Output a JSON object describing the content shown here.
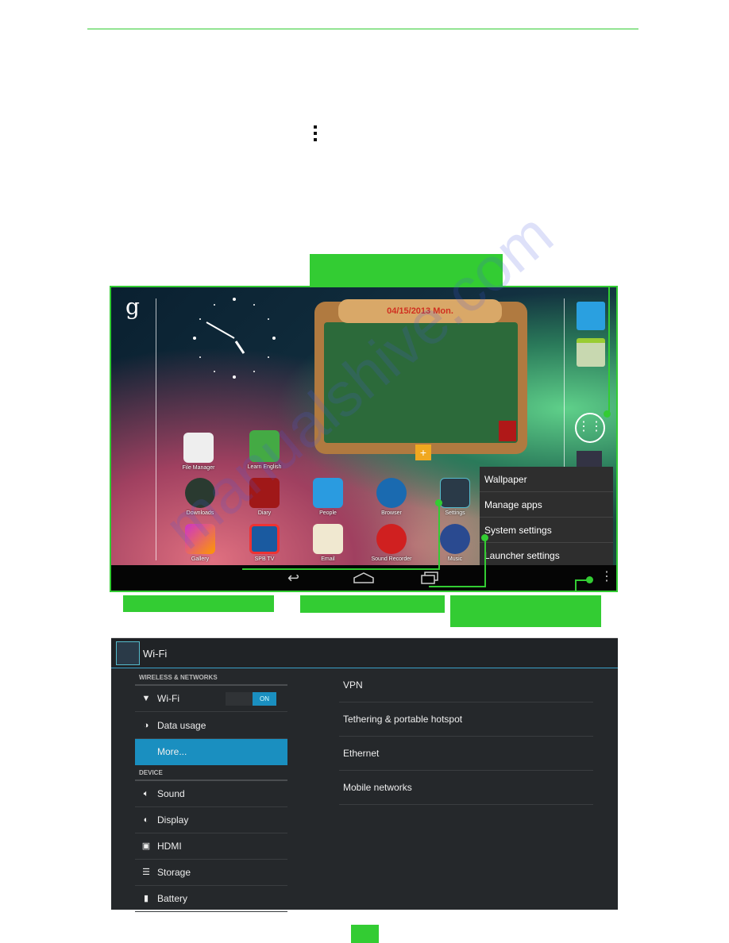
{
  "page": {
    "more_icon": "vertical-ellipsis-icon",
    "accent": "#33cc33",
    "watermark": "manualshive.com"
  },
  "home": {
    "google_letter": "g",
    "date": "04/15/2013 Mon.",
    "apps": [
      {
        "label": "File Manager"
      },
      {
        "label": "Learn English"
      },
      {
        "label": "Downloads"
      },
      {
        "label": "Diary"
      },
      {
        "label": "People"
      },
      {
        "label": "Browser"
      },
      {
        "label": "Settings"
      },
      {
        "label": "Gallery"
      },
      {
        "label": "SPB TV"
      },
      {
        "label": "Email"
      },
      {
        "label": "Sound Recorder"
      },
      {
        "label": "Music"
      }
    ],
    "menu": [
      "Wallpaper",
      "Manage apps",
      "System settings",
      "Launcher settings"
    ]
  },
  "settings": {
    "title": "Wi-Fi",
    "section_wireless": "WIRELESS & NETWORKS",
    "wifi": "Wi-Fi",
    "wifi_toggle": "ON",
    "data_usage": "Data usage",
    "more": "More...",
    "section_device": "DEVICE",
    "device": [
      "Sound",
      "Display",
      "HDMI",
      "Storage",
      "Battery"
    ],
    "right": [
      "VPN",
      "Tethering & portable hotspot",
      "Ethernet",
      "Mobile networks"
    ],
    "selected_color": "#1a8fc0"
  }
}
